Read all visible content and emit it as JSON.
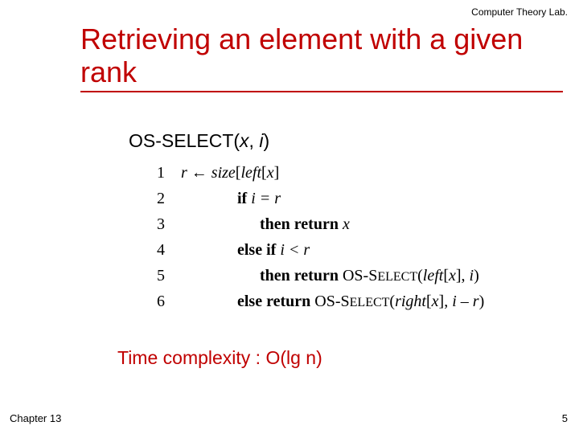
{
  "header_label": "Computer Theory Lab.",
  "title": "Retrieving an element with a given rank",
  "fn": {
    "name1": "OS-S",
    "name2": "ELECT",
    "open": "(",
    "arg1": "x",
    "comma": ", ",
    "arg2": "i",
    "close": ")"
  },
  "lines": {
    "l1": {
      "n": "1",
      "a": "r",
      "arrow": " ← ",
      "b": "size",
      "c": "[",
      "d": "left",
      "e": "[",
      "f": "x",
      "g": "]"
    },
    "l2": {
      "n": "2",
      "a": "if ",
      "b": "i = r"
    },
    "l3": {
      "n": "3",
      "a": "then return ",
      "b": "x"
    },
    "l4": {
      "n": "4",
      "a": "else if ",
      "b": "i < r"
    },
    "l5": {
      "n": "5",
      "a": "then return ",
      "b1": "OS-S",
      "b2": "ELECT",
      "c": "(",
      "d": "left",
      "e": "[",
      "f": "x",
      "g": "], ",
      "h": "i",
      "i": ")"
    },
    "l6": {
      "n": "6",
      "a": "else return ",
      "b1": "OS-S",
      "b2": "ELECT",
      "c": "(",
      "d": "right",
      "e": "[",
      "f": "x",
      "g": "], ",
      "h": "i – r",
      "i": ")"
    }
  },
  "complexity": "Time complexity : O(lg n)",
  "footer_left": "Chapter 13",
  "footer_right": "5"
}
